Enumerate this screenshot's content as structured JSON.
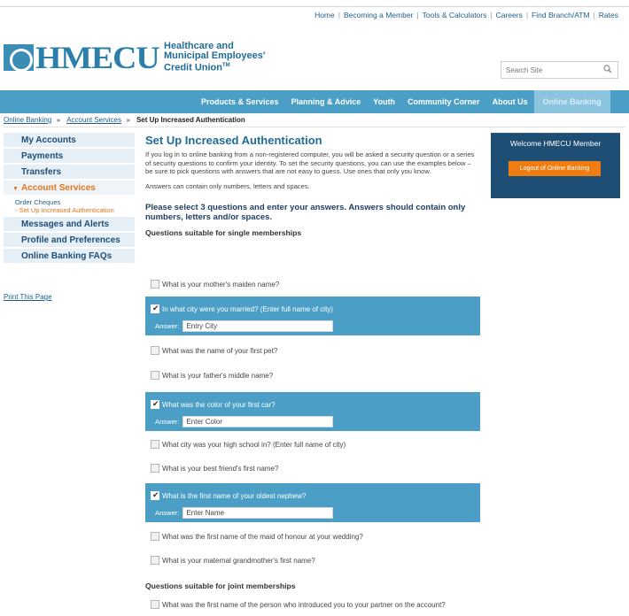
{
  "util_nav": [
    "Home",
    "Becoming a Member",
    "Tools & Calculators",
    "Careers",
    "Find Branch/ATM",
    "Rates"
  ],
  "brand": {
    "logo_text": "HMECU",
    "line1": "Healthcare and",
    "line2": "Municipal Employees'",
    "line3": "Credit Union",
    "tm": "TM"
  },
  "search": {
    "placeholder": "Search Site",
    "icon": "search-icon"
  },
  "main_nav": [
    "Products & Services",
    "Planning & Advice",
    "Youth",
    "Community Corner",
    "About Us",
    "Online Banking"
  ],
  "breadcrumb": {
    "item1": "Online Banking",
    "item2": "Account Services",
    "current": "Set Up Increased Authentication"
  },
  "sidebar": {
    "items": [
      "My Accounts",
      "Payments",
      "Transfers"
    ],
    "open": "Account Services",
    "sub": [
      "Order Cheques",
      "Set Up Increased Authentication"
    ],
    "rest": [
      "Messages and Alerts",
      "Profile and Preferences",
      "Online Banking FAQs"
    ],
    "print": "Print This Page"
  },
  "colors": {
    "nav_blue": "#4b9fc6",
    "dark_blue": "#1f4e75",
    "orange": "#f07d12"
  },
  "content": {
    "title": "Set Up Increased Authentication",
    "intro": "If you log in to online banking from a non-registered computer, you will be asked a security question or a series of security questions to confirm your identity. To set the security questions, you can use the examples below – be sure to pick questions with answers that are not easy to guess. Use ones that only you know.",
    "intro2": "Answers can contain only numbers, letters and spaces.",
    "instruction": "Please select 3 questions and enter your answers. Answers should contain only numbers, letters and/or spaces.",
    "section_single": "Questions suitable for single memberships",
    "section_joint": "Questions suitable for joint memberships",
    "answer_label": "Answer:",
    "questions": [
      {
        "text": "What is your mother's maiden name?",
        "checked": false
      },
      {
        "text": "In what city were you married? (Enter full name of city)",
        "checked": true,
        "answer": "Entry City"
      },
      {
        "text": "What was the name of your first pet?",
        "checked": false
      },
      {
        "text": "What is your father's middle name?",
        "checked": false
      },
      {
        "text": "What was the color of your first car?",
        "checked": true,
        "answer": "Enter Color"
      },
      {
        "text": "What city was your high school in? (Enter full name of city)",
        "checked": false
      },
      {
        "text": "What is your best friend's first name?",
        "checked": false
      },
      {
        "text": "What is the first name of your oldest nephew?",
        "checked": true,
        "answer": "Enter Name"
      },
      {
        "text": "What was the first name of the maid of honour at your wedding?",
        "checked": false
      },
      {
        "text": "What is your maternal grandmother's first name?",
        "checked": false
      }
    ],
    "joint_questions": [
      {
        "text": "What was the first name of the person who introduced you to your partner on the account?",
        "checked": false
      }
    ]
  },
  "welcome": {
    "text": "Welcome HMECU Member",
    "logout": "Logout of Online Banking"
  }
}
